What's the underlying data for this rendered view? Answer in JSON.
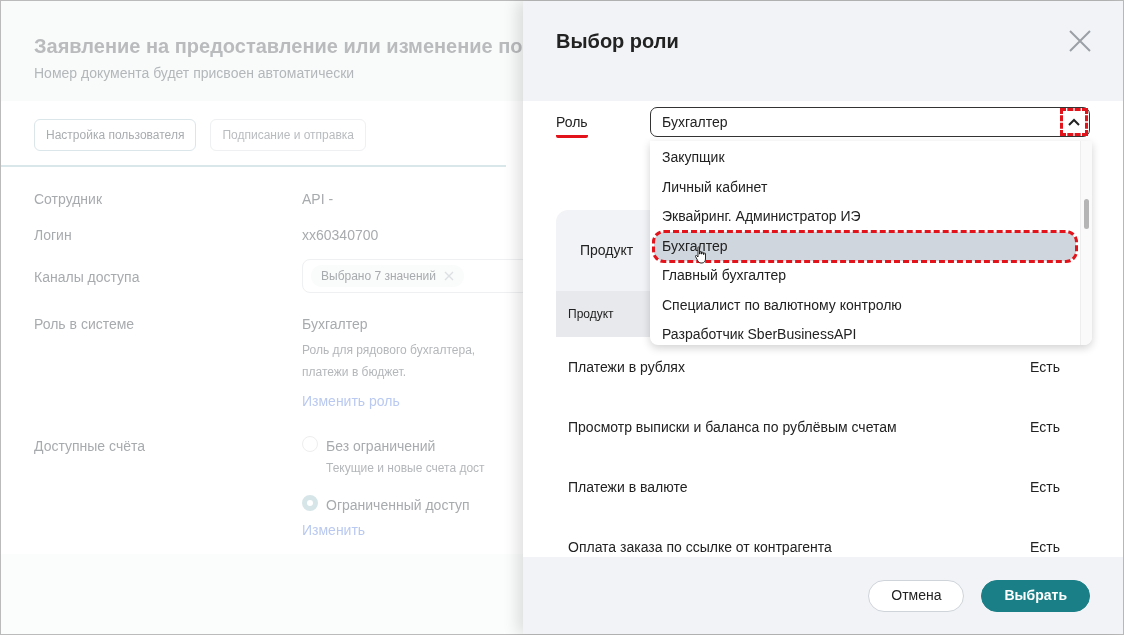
{
  "background_page": {
    "title": "Заявление на предоставление или изменение по",
    "subtitle": "Номер документа будет присвоен автоматически",
    "steps": [
      {
        "label": "Настройка пользователя",
        "selected": true
      },
      {
        "label": "Подписание и отправка",
        "selected": false
      }
    ],
    "fields": [
      {
        "label": "Сотрудник",
        "value": "API -"
      },
      {
        "label": "Логин",
        "value": "xx60340700"
      },
      {
        "label": "Каналы доступа",
        "chip": "Выбрано 7 значений"
      },
      {
        "label": "Роль в системе",
        "value": "Бухгалтер",
        "description": [
          "Роль для рядового бухгалтера,",
          "платежи в бюджет."
        ],
        "link": "Изменить роль"
      },
      {
        "label": "Доступные счёта",
        "options": [
          {
            "label": "Без ограничений",
            "hint": "Текущие и новые счета дост",
            "selected": false
          },
          {
            "label": "Ограниченный доступ",
            "selected": true
          }
        ],
        "link": "Изменить"
      }
    ]
  },
  "drawer": {
    "title": "Выбор роли",
    "role_label": {
      "text": "Роль",
      "annotated": true
    },
    "role_select": {
      "value": "Бухгалтер",
      "expanded": true,
      "toggle_annotated": true
    },
    "options": [
      {
        "label": "Закупщик",
        "selected": false,
        "annotated": false
      },
      {
        "label": "Личный кабинет",
        "selected": false,
        "annotated": false
      },
      {
        "label": "Эквайринг. Администратор ИЭ",
        "selected": false,
        "annotated": false
      },
      {
        "label": "Бухгалтер",
        "selected": true,
        "annotated": true
      },
      {
        "label": "Главный бухгалтер",
        "selected": false,
        "annotated": false
      },
      {
        "label": "Специалист по валютному контролю",
        "selected": false,
        "annotated": false
      },
      {
        "label": "Разработчик SberBusinessAPI",
        "selected": false,
        "annotated": false
      }
    ],
    "product_label": "Продукт",
    "table_header": "Продукт",
    "rows": [
      {
        "name": "Платежи в рублях",
        "value": "Есть"
      },
      {
        "name": "Просмотр выписки и баланса по рублёвым счетам",
        "value": "Есть"
      },
      {
        "name": "Платежи в валюте",
        "value": "Есть"
      },
      {
        "name": "Оплата заказа по ссылке от контрагента",
        "value": "Есть"
      }
    ],
    "buttons": [
      {
        "label": "Отмена",
        "kind": "secondary"
      },
      {
        "label": "Выбрать",
        "kind": "primary"
      }
    ]
  }
}
